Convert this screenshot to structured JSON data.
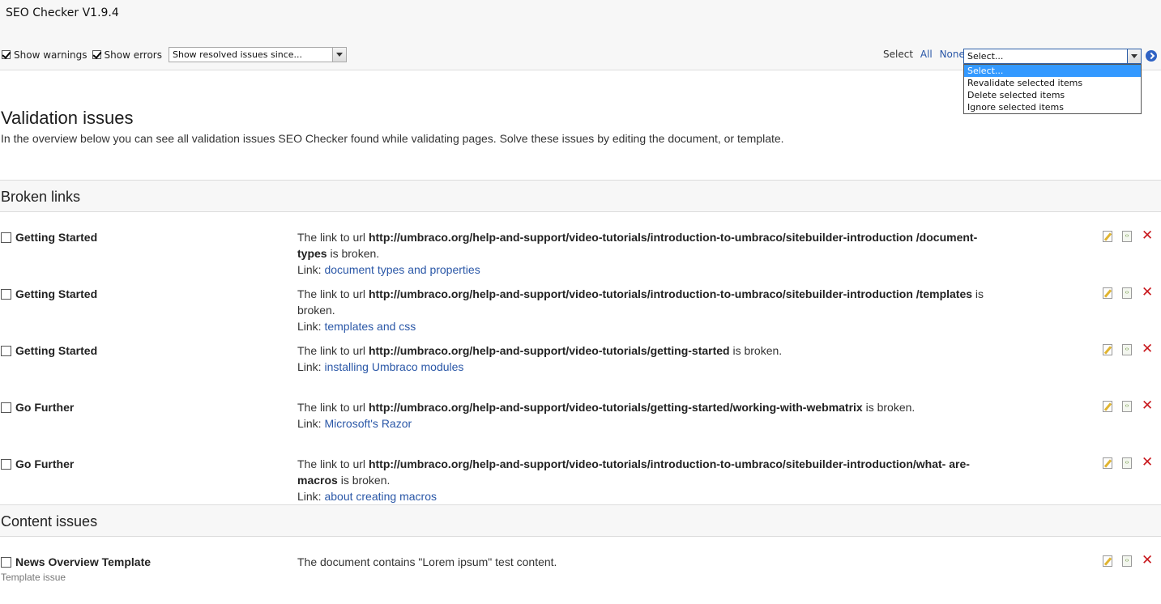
{
  "app": {
    "title": "SEO Checker V1.9.4"
  },
  "toolbar": {
    "show_warnings_label": "Show warnings",
    "show_warnings_checked": true,
    "show_errors_label": "Show errors",
    "show_errors_checked": true,
    "resolved_select_value": "Show resolved issues since...",
    "select_label": "Select",
    "all_label": "All",
    "none_label": "None",
    "action_select_value": "Select...",
    "action_options": [
      "Select...",
      "Revalidate selected items",
      "Delete selected items",
      "Ignore selected items"
    ]
  },
  "page": {
    "title": "Validation issues",
    "description": "In the overview below you can see all validation issues SEO Checker found while validating pages. Solve these issues by editing the document, or template."
  },
  "sections": [
    {
      "title": "Broken links",
      "rows": [
        {
          "name": "Getting Started",
          "prefix": "The link to url ",
          "url": "http://umbraco.org/help-and-support/video-tutorials/introduction-to-umbraco/sitebuilder-introduction /document-types",
          "suffix": " is broken.",
          "link_prefix": "Link: ",
          "link_text": "document types and properties"
        },
        {
          "name": "Getting Started",
          "prefix": "The link to url ",
          "url": "http://umbraco.org/help-and-support/video-tutorials/introduction-to-umbraco/sitebuilder-introduction /templates",
          "suffix": " is broken.",
          "link_prefix": "Link: ",
          "link_text": "templates and css"
        },
        {
          "name": "Getting Started",
          "prefix": "The link to url ",
          "url": "http://umbraco.org/help-and-support/video-tutorials/getting-started",
          "suffix": " is broken.",
          "link_prefix": "Link: ",
          "link_text": "installing Umbraco modules"
        },
        {
          "name": "Go Further",
          "prefix": "The link to url ",
          "url": "http://umbraco.org/help-and-support/video-tutorials/getting-started/working-with-webmatrix",
          "suffix": " is broken.",
          "link_prefix": "Link: ",
          "link_text": "Microsoft's Razor"
        },
        {
          "name": "Go Further",
          "prefix": "The link to url ",
          "url": "http://umbraco.org/help-and-support/video-tutorials/introduction-to-umbraco/sitebuilder-introduction/what- are-macros",
          "suffix": " is broken.",
          "link_prefix": "Link: ",
          "link_text": "about creating macros"
        }
      ]
    },
    {
      "title": "Content issues",
      "rows": [
        {
          "name": "News Overview Template",
          "sub": "Template issue",
          "message": "The document contains \"Lorem ipsum\" test content."
        }
      ]
    }
  ],
  "icons": {
    "edit": "edit-document-icon",
    "template": "template-icon",
    "delete": "delete-icon",
    "go": "go-arrow-icon"
  }
}
